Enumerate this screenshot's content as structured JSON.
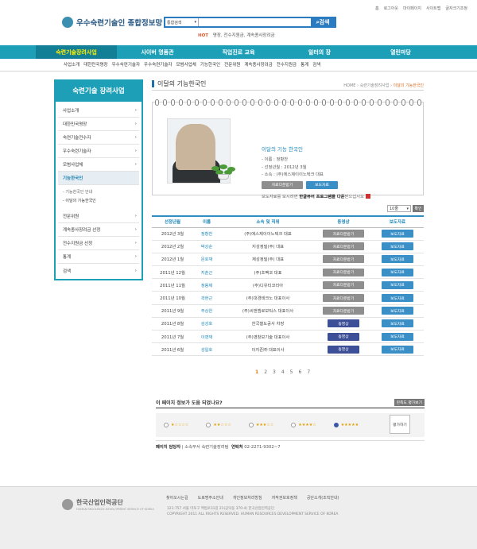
{
  "header": {
    "logo_text": "우수숙련기술인 종합정보망",
    "util_links": [
      "홈",
      "로그아웃",
      "마이페이지",
      "사이트맵",
      "글자크기조정"
    ],
    "search": {
      "select_value": "통합검색",
      "button_label": "검색"
    },
    "hot_label": "HOT",
    "hot_keywords": "명장,   전수지원금,   계속종사장려금"
  },
  "gnb": {
    "items": [
      "숙련기술장려사업",
      "사이버 명품관",
      "직업진로 교육",
      "일터의 장",
      "열린마당"
    ]
  },
  "subnav": {
    "items": [
      "사업소개",
      "대한민국명장",
      "우수숙련기술자",
      "우수숙련기술자",
      "모범사업체",
      "기능한국인",
      "전문위원",
      "계속종사장려금",
      "전수지원금",
      "통계",
      "검색"
    ]
  },
  "lnb": {
    "title": "숙련기술 장려사업",
    "items": [
      "사업소개",
      "대한민국명장",
      "숙련기술전수자",
      "우수숙련기술자",
      "모범사업체",
      "기능한국인"
    ],
    "sub_items": [
      "- 기능한국인 안내",
      "- 이달의 기능한국인"
    ],
    "items_after": [
      "전문위원",
      "계속종사장려금 선정",
      "전수지원금 선정",
      "통계",
      "검색"
    ]
  },
  "content": {
    "title": "이달의 기능한국인",
    "breadcrumb": {
      "home": "HOME",
      "mid": "숙련기술장려사업",
      "current": "이달의 기능한국인"
    },
    "profile": {
      "heading": "이달의 기능 한국인",
      "name_line": "- 이름 : 정항찬",
      "date_line": "- 선정년월 : 2012년 3월",
      "org_line": "- 소속 : (주)에스제이이노텍크 대표",
      "btn_data": "자료다운받기",
      "btn_press": "보도자료",
      "note_pre": "보도자료를 보시려면 ",
      "note_bold": "한글뷰어 프로그램을 다운",
      "note_post": "받으십시오"
    },
    "list_ctrl": {
      "select_value": "10줄",
      "go_label": "확인"
    },
    "columns": [
      "선정년월",
      "이름",
      "소속 및 직위",
      "동영상",
      "보도자료"
    ],
    "rows": [
      {
        "date": "2012년 3월",
        "name": "정항찬",
        "org": "(주)에스제이이노텍크 대표",
        "video": "자료다운받기",
        "video_type": "gray",
        "press": "보도자료"
      },
      {
        "date": "2012년 2월",
        "name": "박상순",
        "org": "지성정밀(주) 대표",
        "video": "자료다운받기",
        "video_type": "gray",
        "press": "보도자료"
      },
      {
        "date": "2012년 1월",
        "name": "문호재",
        "org": "재성정밀(주) 대표",
        "video": "자료다운받기",
        "video_type": "gray",
        "press": "보도자료"
      },
      {
        "date": "2011년 12월",
        "name": "지춘근",
        "org": "(주)초팩코 대표",
        "video": "자료다운받기",
        "video_type": "gray",
        "press": "보도자료"
      },
      {
        "date": "2011년 11월",
        "name": "정용제",
        "org": "(주)디유티코리아",
        "video": "자료다운받기",
        "video_type": "gray",
        "press": "보도자료"
      },
      {
        "date": "2011년 10월",
        "name": "곽현근",
        "org": "(주)대경테크노 대표이사",
        "video": "자료다운받기",
        "video_type": "gray",
        "press": "보도자료"
      },
      {
        "date": "2011년 9월",
        "name": "주상완",
        "org": "(주)씨앤엠로보틱스 대표이사",
        "video": "자료다운받기",
        "video_type": "gray",
        "press": "보도자료"
      },
      {
        "date": "2011년 8월",
        "name": "김성호",
        "org": "한국철도공사 차장",
        "video": "동영상",
        "video_type": "navy",
        "press": "보도자료"
      },
      {
        "date": "2011년 7월",
        "name": "이영재",
        "org": "(주)영창보기술 대표이사",
        "video": "동영상",
        "video_type": "navy",
        "press": "보도자료"
      },
      {
        "date": "2011년 6월",
        "name": "성일호",
        "org": "이지존㈜ 대표이사",
        "video": "동영상",
        "video_type": "navy",
        "press": "보도자료"
      }
    ],
    "paging": [
      "1",
      "2",
      "3",
      "4",
      "5",
      "6",
      "7"
    ]
  },
  "survey": {
    "question": "이 페이지 정보가 도움 되었나요?",
    "result_label": "만족도 평가보기",
    "ratings": [
      "★☆☆☆☆",
      "★★☆☆☆",
      "★★★☆☆",
      "★★★★☆",
      "★★★★★"
    ],
    "selected_index": 4,
    "eval_label": "평가하기",
    "manager_label": "페이지 담당자",
    "dept_label": "소속부서",
    "dept_value": "숙련기술장려팀",
    "contact_label": "연락처",
    "contact_value": "02-2271-9302~7"
  },
  "footer": {
    "org_name": "한국산업인력공단",
    "org_en": "HUMAN RESOURCES DEVELOPMENT SERVICE OF KOREA",
    "links": [
      "찾아오시는길",
      "도로명주소안내",
      "개인정보처리방침",
      "저작권보호정책",
      "공단소개(조직안내)"
    ],
    "address": "121-757 서울 마포구 백범로31길 21(공덕동 370-4) 한국산업인력공단",
    "copyright": "COPYRIGHT 2011 ALL RIGHTS RESERVED. HUMAN RESOURCES DEVELOPMENT SERVICE OF KOREA"
  }
}
